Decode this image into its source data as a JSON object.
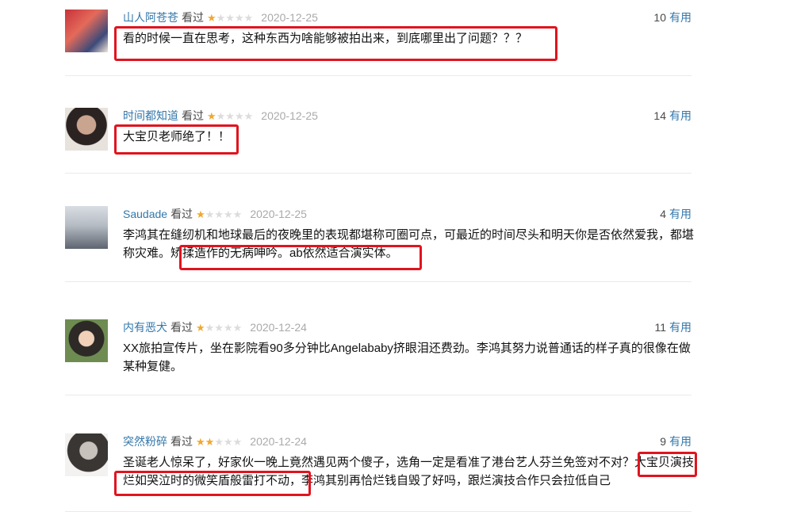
{
  "reviews": [
    {
      "user": "山人阿苍苍",
      "watched": "看过",
      "stars": "★★★★★",
      "rating": 1,
      "date": "2020-12-25",
      "votes": "10",
      "useful": "有用",
      "text": "看的时候一直在思考，这种东西为啥能够被拍出来，到底哪里出了问题？？？"
    },
    {
      "user": "时间都知道",
      "watched": "看过",
      "stars": "★★★★★",
      "rating": 1,
      "date": "2020-12-25",
      "votes": "14",
      "useful": "有用",
      "text": "大宝贝老师绝了！！"
    },
    {
      "user": "Saudade",
      "watched": "看过",
      "stars": "★★★★★",
      "rating": 1,
      "date": "2020-12-25",
      "votes": "4",
      "useful": "有用",
      "text": "李鸿其在缝纫机和地球最后的夜晚里的表现都堪称可圈可点，可最近的时间尽头和明天你是否依然爱我，都堪称灾难。矫揉造作的无病呻吟。ab依然适合演实体。"
    },
    {
      "user": "内有恶犬",
      "watched": "看过",
      "stars": "★★★★★",
      "rating": 1,
      "date": "2020-12-24",
      "votes": "11",
      "useful": "有用",
      "text": "XX旅拍宣传片，坐在影院看90多分钟比Angelababy挤眼泪还费劲。李鸿其努力说普通话的样子真的很像在做某种复健。"
    },
    {
      "user": "突然粉碎",
      "watched": "看过",
      "stars": "★★★★★",
      "rating": 2,
      "date": "2020-12-24",
      "votes": "9",
      "useful": "有用",
      "text": "圣诞老人惊呆了，好家伙一晚上竟然遇见两个傻子，选角一定是看准了港台艺人芬兰免签对不对？大宝贝演技烂如哭泣时的微笑盾般雷打不动，李鸿其别再恰烂钱自毁了好吗，跟烂演技合作只会拉低自己"
    }
  ],
  "colors": {
    "highlight": "#e0141e",
    "link": "#3377aa",
    "star_on": "#f0a82e",
    "star_off": "#dcdcdc"
  }
}
